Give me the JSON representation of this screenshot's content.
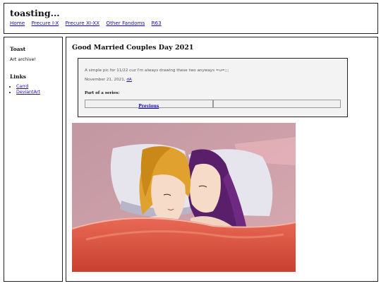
{
  "header": {
    "site_title": "toasting...",
    "nav": [
      "Home",
      "Precure I-X",
      "Precure XI-XX",
      "Other Fandoms",
      "R63"
    ]
  },
  "sidebar": {
    "title": "Toast",
    "about": "Art archive!",
    "links_heading": "Links",
    "links": [
      "Carrd",
      "DeviantArt"
    ]
  },
  "post": {
    "title": "Good Married Couples Day 2021",
    "description": "A simple pic for 11/22 cuz I'm always drawing these two anyways =u=;;;",
    "date": "November 21, 2021,",
    "date_link": "dA",
    "series_label": "Part of a series:",
    "prev_label": "Previous",
    "next_label": ""
  },
  "colors": {
    "link": "#1a0dab",
    "art_background": "#c89aa4",
    "blanket": "#d94c3a",
    "pillow": "#e6e6ee",
    "blonde_hair": "#e0a12e",
    "purple_hair": "#5a1f6b",
    "skin": "#f6dcc8"
  }
}
